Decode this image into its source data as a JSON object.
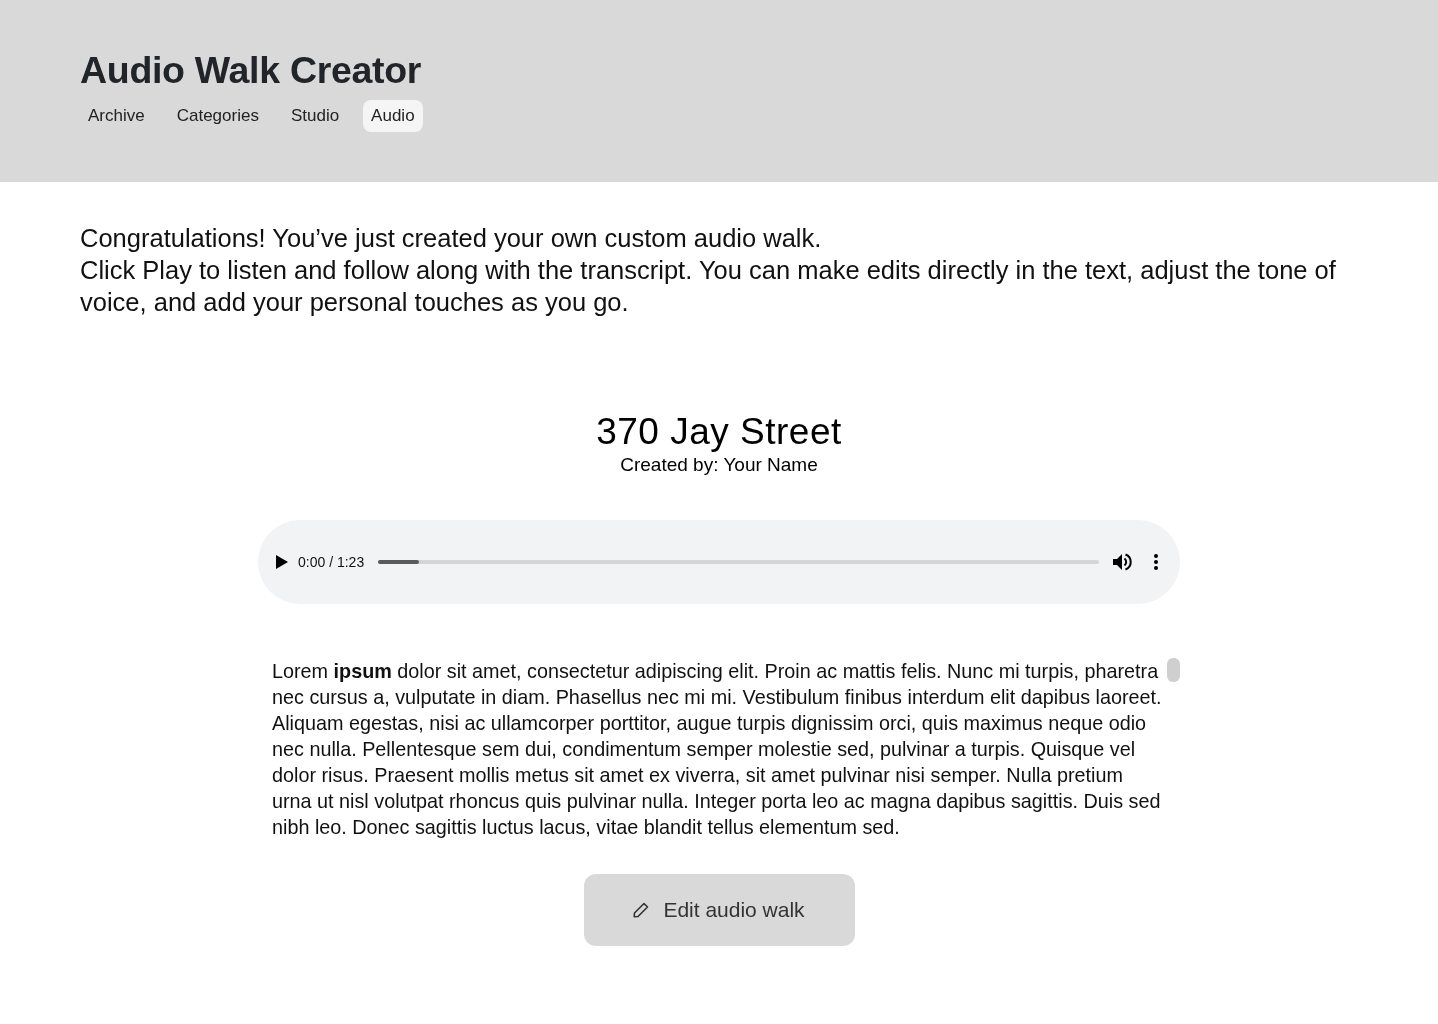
{
  "header": {
    "title": "Audio Walk Creator",
    "nav": [
      {
        "label": "Archive",
        "selected": false
      },
      {
        "label": "Categories",
        "selected": false
      },
      {
        "label": "Studio",
        "selected": false
      },
      {
        "label": "Audio",
        "selected": true
      }
    ]
  },
  "intro": [
    "Congratulations! You’ve just created your own custom audio walk.",
    "Click Play to listen and follow along with the transcript. You can make edits directly in the text, adjust the tone of voice, and add your personal touches as you go."
  ],
  "walk": {
    "title": "370 Jay Street",
    "byline": "Created by: Your Name"
  },
  "player": {
    "time": "0:00 / 1:23",
    "level": 0.057
  },
  "transcript": "Lorem **ipsum** dolor sit amet, consectetur adipiscing elit. Proin ac mattis felis. Nunc mi turpis, pharetra nec cursus a, vulputate in diam. Phasellus nec mi mi. Vestibulum finibus interdum elit dapibus laoreet. Aliquam egestas, nisi ac ullamcorper porttitor, augue turpis dignissim orci, quis maximus neque odio nec nulla. Pellentesque sem dui, condimentum semper molestie sed, pulvinar a turpis. Quisque vel dolor risus. Praesent mollis metus sit amet ex viverra, sit amet pulvinar nisi semper. Nulla pretium urna ut nisl volutpat rhoncus quis pulvinar nulla. Integer porta leo ac magna dapibus sagittis. Duis sed nibh leo. Donec sagittis luctus lacus, vitae blandit tellus elementum sed.",
  "edit_button": {
    "label": "Edit audio walk"
  }
}
